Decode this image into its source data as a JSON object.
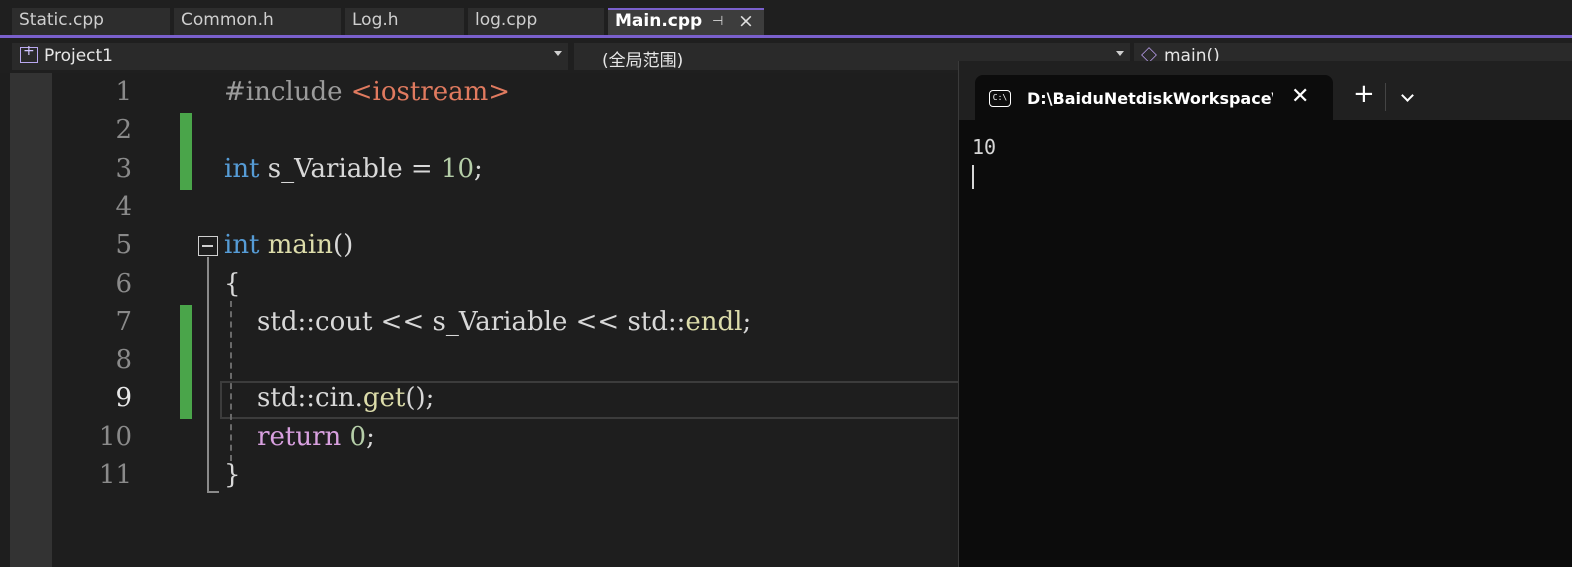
{
  "tabs": [
    {
      "label": "Static.cpp",
      "active": false
    },
    {
      "label": "Common.h",
      "active": false
    },
    {
      "label": "Log.h",
      "active": false
    },
    {
      "label": "log.cpp",
      "active": false
    },
    {
      "label": "Main.cpp",
      "active": true
    }
  ],
  "navbar": {
    "project": "Project1",
    "scope": "(全局范围)",
    "member": "main()"
  },
  "editor": {
    "line_numbers": [
      "1",
      "2",
      "3",
      "4",
      "5",
      "6",
      "7",
      "8",
      "9",
      "10",
      "11"
    ],
    "current_line": 9,
    "changed_lines": [
      2,
      3,
      7,
      8,
      9
    ],
    "lines": [
      {
        "n": 1,
        "tokens": [
          {
            "t": "#include ",
            "c": "pp"
          },
          {
            "t": "<iostream>",
            "c": "inc"
          }
        ]
      },
      {
        "n": 2,
        "tokens": []
      },
      {
        "n": 3,
        "tokens": [
          {
            "t": "int",
            "c": "kw"
          },
          {
            "t": " s_Variable = ",
            "c": ""
          },
          {
            "t": "10",
            "c": "num"
          },
          {
            "t": ";",
            "c": ""
          }
        ]
      },
      {
        "n": 4,
        "tokens": []
      },
      {
        "n": 5,
        "tokens": [
          {
            "t": "int",
            "c": "kw"
          },
          {
            "t": " ",
            "c": ""
          },
          {
            "t": "main",
            "c": "fn"
          },
          {
            "t": "()",
            "c": ""
          }
        ]
      },
      {
        "n": 6,
        "tokens": [
          {
            "t": "{",
            "c": ""
          }
        ]
      },
      {
        "n": 7,
        "tokens": [
          {
            "t": "    std::cout << s_Variable << std::",
            "c": ""
          },
          {
            "t": "endl",
            "c": "fn"
          },
          {
            "t": ";",
            "c": ""
          }
        ]
      },
      {
        "n": 8,
        "tokens": []
      },
      {
        "n": 9,
        "tokens": [
          {
            "t": "    std::cin.",
            "c": ""
          },
          {
            "t": "get",
            "c": "fn"
          },
          {
            "t": "();",
            "c": ""
          }
        ]
      },
      {
        "n": 10,
        "tokens": [
          {
            "t": "    ",
            "c": ""
          },
          {
            "t": "return",
            "c": "ctl"
          },
          {
            "t": " ",
            "c": ""
          },
          {
            "t": "0",
            "c": "num"
          },
          {
            "t": ";",
            "c": ""
          }
        ]
      },
      {
        "n": 11,
        "tokens": [
          {
            "t": "}",
            "c": ""
          }
        ]
      }
    ]
  },
  "terminal": {
    "tab_title": "D:\\BaiduNetdiskWorkspace\\E",
    "icon_text": "C:\\",
    "output": "10"
  }
}
